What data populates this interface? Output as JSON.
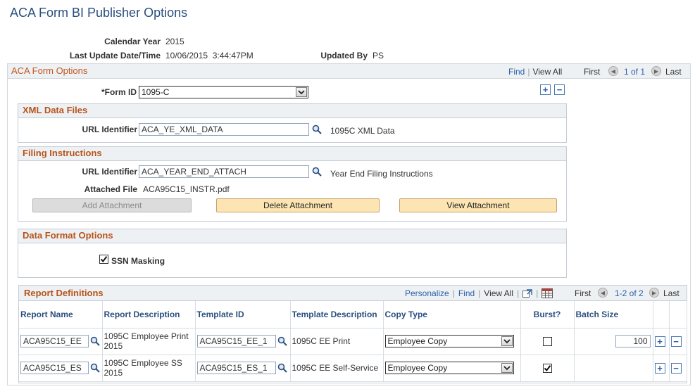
{
  "page": {
    "title": "ACA Form BI Publisher Options"
  },
  "summary": {
    "calendar_year_label": "Calendar Year",
    "calendar_year": "2015",
    "last_update_label": "Last Update Date/Time",
    "last_update": "10/06/2015  3:44:47PM",
    "updated_by_label": "Updated By",
    "updated_by": "PS"
  },
  "form_options": {
    "title": "ACA Form Options",
    "find": "Find",
    "view_all": "View All",
    "first": "First",
    "count": "1 of 1",
    "last": "Last",
    "form_id_label": "*Form ID",
    "form_id": "1095-C",
    "add_row": "+",
    "delete_row": "−"
  },
  "xml_data_files": {
    "title": "XML Data Files",
    "url_label": "URL Identifier",
    "url_value": "ACA_YE_XML_DATA",
    "url_desc": "1095C XML Data"
  },
  "filing_instructions": {
    "title": "Filing Instructions",
    "url_label": "URL Identifier",
    "url_value": "ACA_YEAR_END_ATTACH",
    "url_desc": "Year End Filing Instructions",
    "attached_label": "Attached File",
    "attached_file": "ACA95C15_INSTR.pdf",
    "add_attachment": "Add Attachment",
    "delete_attachment": "Delete Attachment",
    "view_attachment": "View Attachment"
  },
  "data_format": {
    "title": "Data Format Options",
    "ssn_label": "SSN Masking",
    "ssn_checked": true
  },
  "report_definitions": {
    "title": "Report Definitions",
    "personalize": "Personalize",
    "find": "Find",
    "view_all": "View All",
    "first": "First",
    "count": "1-2 of 2",
    "last": "Last",
    "columns": [
      "Report Name",
      "Report Description",
      "Template ID",
      "Template Description",
      "Copy Type",
      "Burst?",
      "Batch Size"
    ],
    "rows": [
      {
        "report_name": "ACA95C15_EE",
        "report_desc": "1095C Employee Print 2015",
        "template_id": "ACA95C15_EE_1",
        "template_desc": "1095C EE Print",
        "copy_type": "Employee Copy",
        "burst": false,
        "batch_size": "100"
      },
      {
        "report_name": "ACA95C15_ES",
        "report_desc": "1095C Employee SS 2015",
        "template_id": "ACA95C15_ES_1",
        "template_desc": "1095C EE Self-Service",
        "copy_type": "Employee Copy",
        "burst": true,
        "batch_size": ""
      }
    ]
  },
  "icons": {
    "lookup": "magnifier-icon",
    "dropdown": "chevron-down-icon",
    "nav_prev": "arrow-left-icon",
    "nav_next": "arrow-right-icon",
    "zoom": "zoom-icon",
    "grid": "grid-download-icon"
  },
  "colors": {
    "title_blue": "#2a4f7f",
    "section_orange": "#c1581f",
    "link_blue": "#2a5ea8",
    "button_fill": "#fde5b3"
  }
}
